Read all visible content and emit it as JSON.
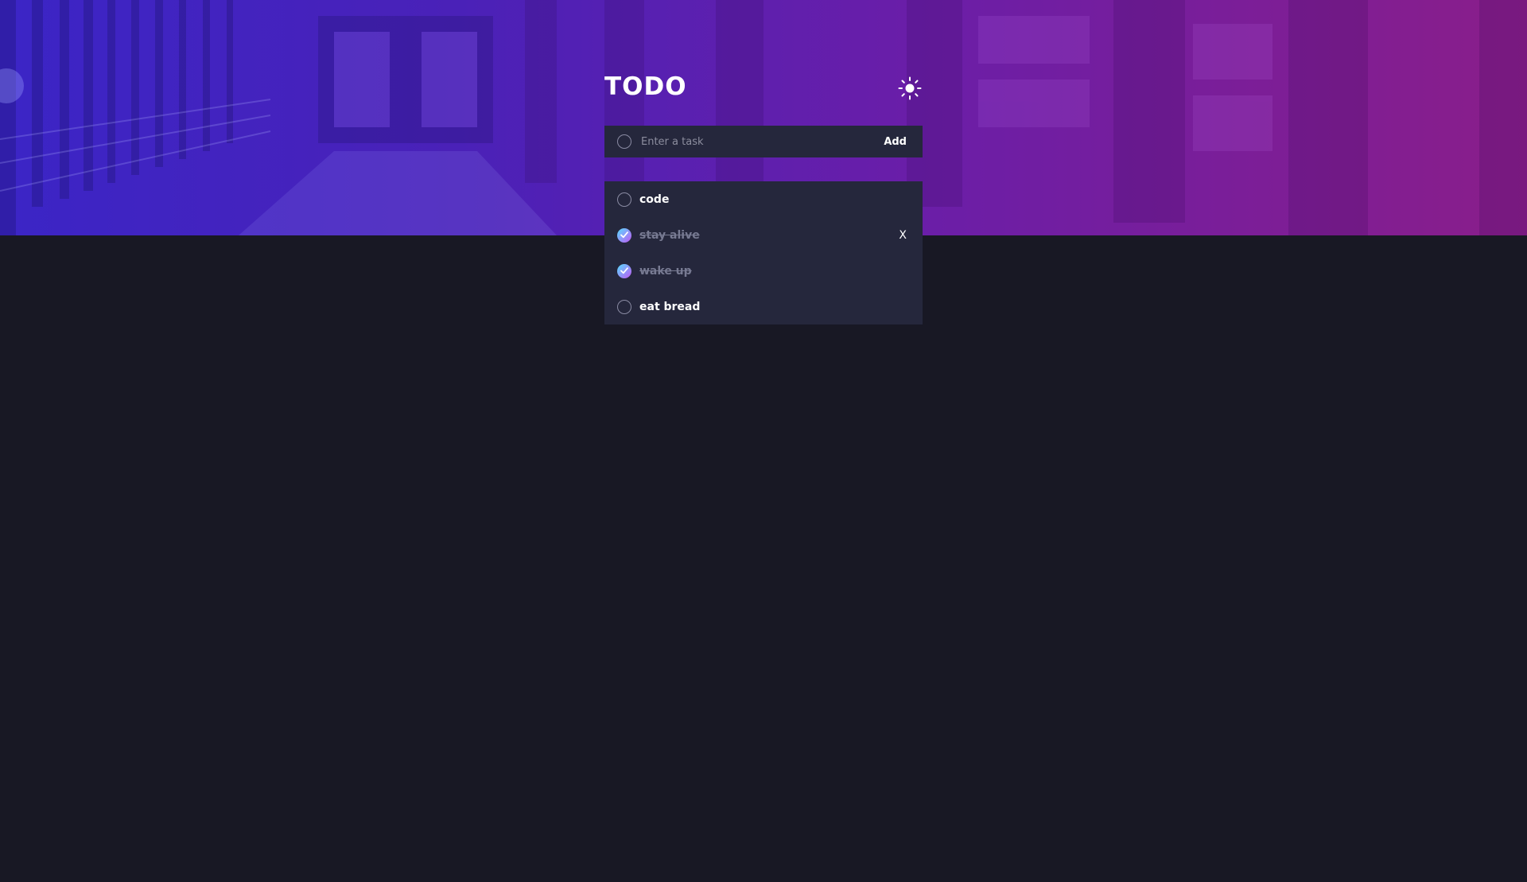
{
  "app": {
    "title": "TODO",
    "theme_icon": "sun-icon"
  },
  "new_task": {
    "placeholder": "Enter a task",
    "add_label": "Add",
    "value": ""
  },
  "tasks": [
    {
      "label": "code",
      "completed": false
    },
    {
      "label": "stay alive",
      "completed": true,
      "delete_label": "X"
    },
    {
      "label": "wake up",
      "completed": true
    },
    {
      "label": "eat bread",
      "completed": false
    }
  ],
  "colors": {
    "background": "#181824",
    "card": "#25273c",
    "accent_start": "#57ddff",
    "accent_end": "#c058f3",
    "hero_left": "#3b25c6",
    "hero_right": "#8a1e8a"
  }
}
